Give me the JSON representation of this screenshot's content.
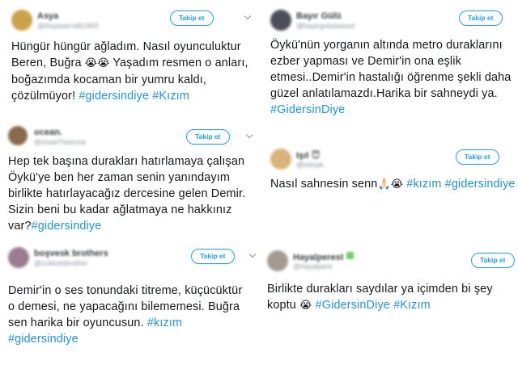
{
  "follow_label": "Takip et",
  "tweets": [
    {
      "name": "Asya",
      "handle": "@AsyaserraB1993",
      "avatar_color": "#c9a34a",
      "text": "Hüngür hüngür ağladım. Nasıl oyunculuktur Beren, Buğra ",
      "emoji": "😭😭",
      "text2": " Yaşadım resmen o anları, boğazımda kocaman bir yumru kaldı, çözülmüyor! ",
      "tags": "#gidersindiye #Kızım"
    },
    {
      "name": "Bayır Gülü",
      "handle": "@bayirgulubeaver",
      "avatar_color": "#4a4f58",
      "text": "Öykü'nün yorganın altında metro duraklarını ezber yapması ve Demir'in ona eşlik etmesi..Demir'in hastalığı öğrenme şekli daha güzel anlatılamazdı.Harika bir sahneydi ya. ",
      "tags": "#GidersinDiye"
    },
    {
      "name": "ocean.",
      "handle": "@oceaTheocea",
      "avatar_color": "#8a6a4c",
      "text": "Hep tek başına durakları hatırlamaya çalışan Öykü'ye ben her zaman senin yanındayım birlikte hatırlayacağız dercesine gelen Demir. Sizin beni bu kadar ağlatmaya ne hakkınız var?",
      "tags": "#gidersindiye"
    },
    {
      "name": "Işıl 😇",
      "handle": "@isiluyk",
      "avatar_color": "#d8b478",
      "text": "Nasıl sahnesin senn",
      "emoji": "🙏🏻😭",
      "tags": "#kızım #gidersindiye"
    },
    {
      "name": "boşvesk brothers",
      "handle": "@cuboshbrother",
      "avatar_color": "#9a7b8f",
      "text": "Demir'in o ses tonundaki titreme, küçücüktür o demesi, ne yapacağını bilememesi. Buğra sen harika bir oyuncusun. ",
      "tags": "#kızım #gidersindiye"
    },
    {
      "name": "Hayalperest",
      "handle": "@hayalpere",
      "avatar_color": "#a59a92",
      "text": "Birlikte durakları saydılar ya içimden bi şey koptu ",
      "emoji": "😭",
      "tags": "#GidersinDiye #Kızım"
    }
  ]
}
